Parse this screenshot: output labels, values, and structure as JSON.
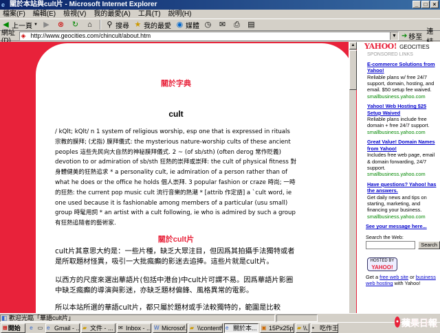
{
  "window": {
    "title": "關於本站與cult片 - Microsoft Internet Explorer"
  },
  "menu": [
    "檔案(F)",
    "編輯(E)",
    "檢視(V)",
    "我的最愛(A)",
    "工具(T)",
    "說明(H)"
  ],
  "toolbar": {
    "back": "上一頁",
    "search": "搜尋",
    "favorites": "我的最愛",
    "media": "媒體"
  },
  "address": {
    "label": "網址(D)",
    "url": "http://www.geocities.com/chincult/about.htm",
    "go": "移至",
    "links": "連結"
  },
  "article": {
    "heading1": "關於字典",
    "word": "cult",
    "definition": "/ kQlt; kQlt/ n 1 system of religious worship, esp one that is expressed in rituals 宗教的膜拜; (尤指) 膜拜儀式: the mysterious nature-worship cults of these ancient peoples 這些先民向大自然的神秘膜拜儀式. 2 ~ (of sb/sth) (often derog 常作貶義) devotion to or admiration of sb/sth 狂熱的崇拜或崇拜: the cult of physical fitness 對身體健美的狂熱追求 * a personality cult, ie admiration of a person rather than of what he does or the office he holds 個人崇拜. 3 popular fashion or craze 時尚; 一時的狂熱: the current pop music cult 流行音樂的熱潮 * [attrib 作定語] a `cult word, ie one used because it is fashionable among members of a particular (usu small) group 時髦用詞 * an artist with a cult following, ie who is admired by such a group 有狂熱追隨者的藝術家.",
    "heading2": "關於cult片",
    "para1": "cult片其意思大約是：一些片種，缺乏大眾注目，但因爲其拍攝手法獨特或者是所取題材怪異，吸引一大批瘋癲的影迷去追捧。這些片就是cult片。",
    "para2": "以西方的尺度來選出華語片(包括中港台)中cult片可謂不易。因爲華語片影圈中缺乏瘋癲的導演與影迷，亦缺乏題材偏鋒、風格異常的電影。",
    "para3": "所以本站所選的華語cult片，都只屬於題材或手法較獨特的，範圍是比較"
  },
  "sidebar": {
    "logo": "YAHOO!",
    "geocities": "GEOCITIES",
    "sponsored": "SPONSORED LINKS",
    "ads": [
      {
        "title": "E-commerce Solutions from Yahoo!",
        "body": "Reliable plans w/ free 24/7 support, domain, hosting, and email. $50 setup fee waived.",
        "url": "smallbusiness.yahoo.com"
      },
      {
        "title": "Yahoo! Web Hosting $25 Setup Waived",
        "body": "Reliable plans include free domain + free 24/7 support.",
        "url": "smallbusiness.yahoo.com"
      },
      {
        "title": "Great Value! Domain Names from Yahoo!",
        "body": "Includes free web page, email & domain forwarding, 24/7 support.",
        "url": "smallbusiness.yahoo.com"
      },
      {
        "title": "Have questions? Yahoo! has the answers.",
        "body": "Get daily news and tips on starting, marketing, and financing your business.",
        "url": "smallbusiness.yahoo.com"
      }
    ],
    "see_more": "See your message here...",
    "search_label": "Search the Web:",
    "search_button": "Search",
    "hosted_by": "HOSTED BY",
    "hosted_logo": "YAHOO!",
    "getfree_pre": "Get a ",
    "getfree_link1": "free web site",
    "getfree_mid": " or ",
    "getfree_link2": "business web hosting",
    "getfree_post": " with Yahoo!"
  },
  "status": {
    "text": "歡迎光臨「華語cult片」"
  },
  "taskbar": {
    "start": "開始",
    "tasks": [
      "Gmail - ...",
      "文件 - ...",
      "Inbox - ...",
      "Microsof...",
      "\\\\content\\...",
      "關於本...",
      "15Px25p...",
      "\\\\...",
      "吃作王..."
    ]
  },
  "watermark": {
    "text": "蘋果日報"
  }
}
